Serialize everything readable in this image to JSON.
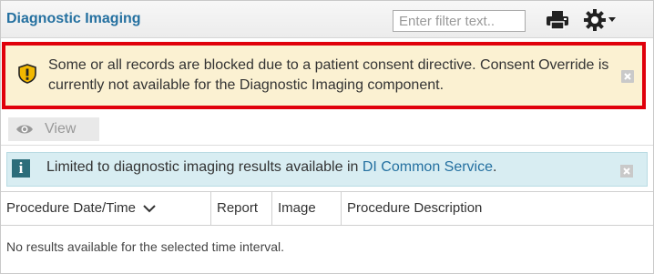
{
  "header": {
    "title": "Diagnostic Imaging",
    "filter_placeholder": "Enter filter text..",
    "icons": [
      "print-icon",
      "gear-icon",
      "chevron-down-icon"
    ]
  },
  "consent_alert": {
    "text": "Some or all records are blocked due to a patient consent directive. Consent Override is currently not available for the Diagnostic Imaging component.",
    "icon": "shield-icon",
    "highlight_color": "#e0000b",
    "background": "#fbf1d2"
  },
  "toolbar": {
    "view_label": "View",
    "icon": "eye-icon"
  },
  "info": {
    "text_before": "Limited to diagnostic imaging results available in ",
    "link_text": "DI Common Service",
    "text_after": ".",
    "icon": "info-icon",
    "background": "#d8edf2"
  },
  "table": {
    "columns": [
      "Procedure Date/Time",
      "Report",
      "Image",
      "Procedure Description"
    ],
    "empty_message": "No results available for the selected time interval."
  }
}
